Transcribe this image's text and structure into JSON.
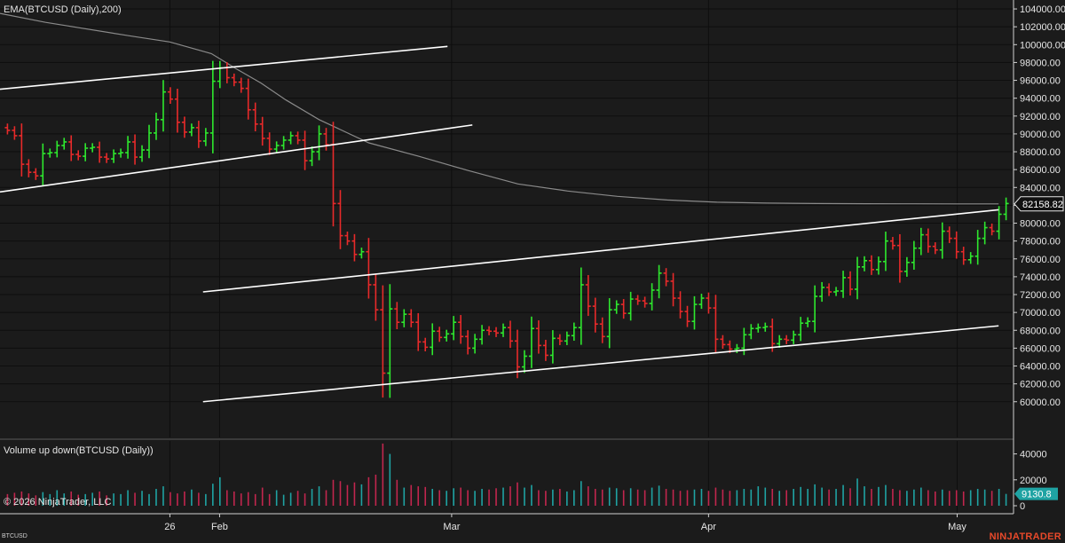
{
  "header": {
    "indicator_label": "EMA(BTCUSD (Daily),200)",
    "volume_label": "Volume up down(BTCUSD (Daily))",
    "copyright": "© 2026 NinjaTrader, LLC",
    "symbol": "BTCUSD",
    "brand": "NINJATRADER"
  },
  "colors": {
    "background": "#1b1b1b",
    "up": "#2ee82e",
    "down": "#e82a2a",
    "volume_up": "#1fa3a3",
    "volume_down": "#c2264e",
    "ema": "#8a8a8a",
    "trendline": "#ffffff",
    "grid": "#000000"
  },
  "chart_data": [
    {
      "type": "ohlc",
      "title": "EMA(BTCUSD (Daily),200)",
      "x_tick_labels": [
        {
          "label": "26",
          "day": 0
        },
        {
          "label": "Feb",
          "day": 6
        },
        {
          "label": "Mar",
          "day": 34
        },
        {
          "label": "Apr",
          "day": 65
        },
        {
          "label": "May",
          "day": 95
        }
      ],
      "day_range": [
        -20.5,
        101.8
      ],
      "ylim": [
        56000,
        105000
      ],
      "y_ticks": [
        60000,
        62000,
        64000,
        66000,
        68000,
        70000,
        72000,
        74000,
        76000,
        78000,
        80000,
        82000,
        84000,
        86000,
        88000,
        90000,
        92000,
        94000,
        96000,
        98000,
        100000,
        102000,
        104000
      ],
      "last_price": "82158.82",
      "last_value": 82158.82,
      "grid": true,
      "closes": [
        90400,
        89800,
        86600,
        85700,
        85300,
        87800,
        87900,
        88700,
        89100,
        87700,
        87500,
        88400,
        88500,
        87400,
        87200,
        87800,
        87900,
        89100,
        87400,
        88200,
        90100,
        91600,
        94700,
        93900,
        91300,
        90200,
        90700,
        89200,
        90100,
        95900,
        97400,
        96300,
        95800,
        95100,
        92700,
        91100,
        89500,
        88300,
        88700,
        89300,
        89800,
        89300,
        87000,
        88000,
        90000,
        88800,
        82200,
        78600,
        78000,
        76500,
        76800,
        73100,
        70300,
        63200,
        70400,
        68900,
        69800,
        68900,
        66700,
        66100,
        67900,
        67200,
        67600,
        68900,
        67300,
        66000,
        67000,
        68000,
        67900,
        67700,
        68300,
        66800,
        63900,
        65100,
        68200,
        66300,
        65200,
        67100,
        66800,
        67400,
        68300,
        73100,
        70700,
        68700,
        67300,
        70300,
        70900,
        69900,
        71500,
        71300,
        71000,
        72500,
        74400,
        73500,
        71600,
        70100,
        69000,
        70900,
        71600,
        70500,
        67000,
        66400,
        65900,
        66000,
        67500,
        68200,
        68300,
        68400,
        66500,
        67000,
        66900,
        67500,
        68800,
        69000,
        71800,
        72800,
        72300,
        72400,
        73900,
        72600,
        75100,
        75800,
        74800,
        75700,
        78000,
        77500,
        74600,
        75600,
        77200,
        78700,
        77400,
        77000,
        79100,
        78300,
        76800,
        75900,
        76300,
        78300,
        79500,
        79100,
        81000,
        82200
      ],
      "lower_channel_1": {
        "points": [
          [
            -20.5,
            83500
          ],
          [
            36.5,
            91000
          ]
        ]
      },
      "upper_channel_1": {
        "points": [
          [
            -20.5,
            95000
          ],
          [
            33.5,
            99800
          ]
        ]
      },
      "upper_channel_2": {
        "points": [
          [
            4.0,
            72300
          ],
          [
            100.0,
            81500
          ]
        ]
      },
      "lower_channel_2": {
        "points": [
          [
            4.0,
            60000
          ],
          [
            100.0,
            68500
          ]
        ]
      },
      "ema_200": {
        "points": [
          [
            -20.5,
            103500
          ],
          [
            -15,
            102500
          ],
          [
            -5,
            101000
          ],
          [
            0,
            100300
          ],
          [
            5,
            99000
          ],
          [
            8,
            97300
          ],
          [
            11,
            95700
          ],
          [
            14,
            93800
          ],
          [
            18,
            91600
          ],
          [
            24,
            89000
          ],
          [
            30,
            87500
          ],
          [
            36,
            85900
          ],
          [
            42,
            84400
          ],
          [
            48,
            83600
          ],
          [
            54,
            83000
          ],
          [
            60,
            82600
          ],
          [
            66,
            82350
          ],
          [
            72,
            82250
          ],
          [
            78,
            82200
          ],
          [
            84,
            82180
          ],
          [
            90,
            82170
          ],
          [
            95,
            82160
          ],
          [
            100.0,
            82158.82
          ]
        ]
      }
    },
    {
      "type": "bar",
      "title": "Volume up down(BTCUSD (Daily))",
      "ylim": [
        0,
        50000
      ],
      "y_ticks": [
        0,
        20000,
        40000
      ],
      "last_volume": "9130.8",
      "last_value": 9130.8,
      "volumes": [
        9000,
        10000,
        11000,
        9500,
        8000,
        10500,
        9000,
        12000,
        9500,
        11000,
        8500,
        9000,
        10000,
        11000,
        8000,
        9500,
        9000,
        12000,
        10000,
        11500,
        9000,
        13000,
        15000,
        10500,
        9500,
        11000,
        12500,
        10000,
        9000,
        17000,
        22000,
        12000,
        11000,
        9500,
        10500,
        9000,
        14000,
        9000,
        12000,
        8500,
        10000,
        11500,
        9500,
        13000,
        15000,
        12000,
        20000,
        19000,
        16000,
        18000,
        16500,
        22000,
        24000,
        48000,
        40000,
        20000,
        14000,
        16000,
        15000,
        14500,
        13000,
        12000,
        11500,
        13500,
        14000,
        12000,
        11500,
        13000,
        12500,
        13500,
        14000,
        15000,
        18000,
        14000,
        16000,
        12000,
        11500,
        12500,
        13000,
        11000,
        12000,
        19000,
        15000,
        13000,
        12500,
        14000,
        13500,
        12000,
        13500,
        12500,
        12000,
        14000,
        15500,
        13000,
        12500,
        11500,
        12000,
        12500,
        13000,
        11500,
        14000,
        12500,
        11500,
        12000,
        13000,
        12500,
        15000,
        14000,
        13000,
        11500,
        12000,
        13000,
        14500,
        13000,
        16500,
        14000,
        12500,
        13000,
        16000,
        13500,
        21000,
        15000,
        13000,
        14500,
        16000,
        13000,
        12000,
        11500,
        12500,
        14000,
        12000,
        11000,
        12500,
        11500,
        12000,
        11000,
        12000,
        13000,
        12500,
        11500,
        13000,
        9130.8
      ]
    }
  ]
}
